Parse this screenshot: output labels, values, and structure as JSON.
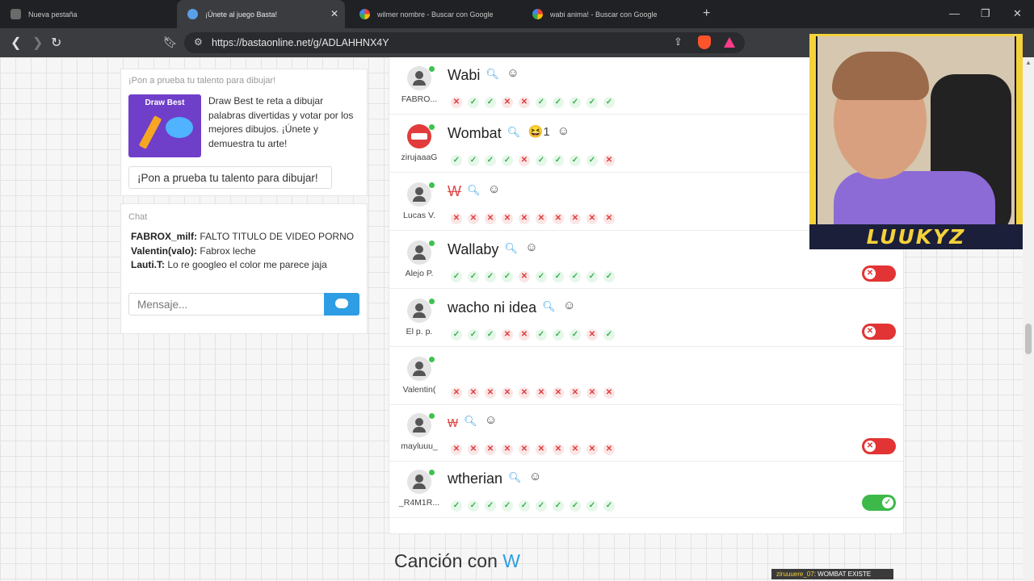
{
  "browser": {
    "tabs": [
      {
        "title": "Nueva pestaña",
        "active": false
      },
      {
        "title": "¡Únete al juego Basta!",
        "active": true
      },
      {
        "title": "wilmer nombre - Buscar con Google",
        "active": false
      },
      {
        "title": "wabi anima! - Buscar con Google",
        "active": false
      }
    ],
    "new_tab": "+",
    "url": "https://bastaonline.net/g/ADLAHHNX4Y",
    "icons": {
      "back": "back-icon",
      "forward": "forward-icon",
      "reload": "reload-icon",
      "bookmark": "bookmark-icon",
      "share": "share-icon",
      "brave": "brave-shield-icon",
      "rewards": "brave-rewards-icon"
    },
    "brave_count": "4"
  },
  "promo": {
    "header": "¡Pon a prueba tu talento para dibujar!",
    "image_title": "Draw Best",
    "text": "Draw Best te reta a dibujar palabras divertidas y votar por los mejores dibujos. ¡Únete y demuestra tu arte!",
    "button": "¡Pon a prueba tu talento para dibujar!"
  },
  "chat": {
    "header": "Chat",
    "messages": [
      {
        "user": "FABROX_milf:",
        "text": "FALTO TITULO DE VIDEO PORNO"
      },
      {
        "user": "Valentin(valo):",
        "text": "Fabrox leche"
      },
      {
        "user": "Lauti.T:",
        "text": "Lo re googleo el color me parece jaja"
      }
    ],
    "placeholder": "Mensaje..."
  },
  "answers": [
    {
      "user": "FABRO...",
      "word": "Wabi",
      "valid": true,
      "reaction": "",
      "marks": [
        "no",
        "ok",
        "ok",
        "no",
        "no",
        "ok",
        "ok",
        "ok",
        "ok",
        "ok"
      ],
      "toggle": ""
    },
    {
      "user": "zirujaaaG",
      "word": "Wombat",
      "valid": true,
      "reaction": "😆1",
      "marks": [
        "ok",
        "ok",
        "ok",
        "ok",
        "no",
        "ok",
        "ok",
        "ok",
        "ok",
        "no"
      ],
      "toggle": "",
      "avatar": "stop"
    },
    {
      "user": "Lucas V.",
      "word": "W",
      "valid": false,
      "reaction": "",
      "marks": [
        "no",
        "no",
        "no",
        "no",
        "no",
        "no",
        "no",
        "no",
        "no",
        "no"
      ],
      "toggle": ""
    },
    {
      "user": "Alejo P.",
      "word": "Wallaby",
      "valid": true,
      "reaction": "",
      "marks": [
        "ok",
        "ok",
        "ok",
        "ok",
        "no",
        "ok",
        "ok",
        "ok",
        "ok",
        "ok"
      ],
      "toggle": "off"
    },
    {
      "user": "El p. p.",
      "word": "wacho ni idea",
      "valid": true,
      "reaction": "",
      "marks": [
        "ok",
        "ok",
        "ok",
        "no",
        "no",
        "ok",
        "ok",
        "ok",
        "no",
        "ok"
      ],
      "toggle": "off"
    },
    {
      "user": "Valentin(",
      "word": "",
      "valid": false,
      "reaction": "",
      "marks": [
        "no",
        "no",
        "no",
        "no",
        "no",
        "no",
        "no",
        "no",
        "no",
        "no"
      ],
      "toggle": ""
    },
    {
      "user": "mayluuu_",
      "word": "w",
      "valid": false,
      "reaction": "",
      "marks": [
        "no",
        "no",
        "no",
        "no",
        "no",
        "no",
        "no",
        "no",
        "no",
        "no"
      ],
      "toggle": "off"
    },
    {
      "user": "_R4M1R...",
      "word": "wtherian",
      "valid": true,
      "reaction": "",
      "marks": [
        "ok",
        "ok",
        "ok",
        "ok",
        "ok",
        "ok",
        "ok",
        "ok",
        "ok",
        "ok"
      ],
      "toggle": "on"
    }
  ],
  "next_section": {
    "label": "Canción con",
    "letter": "W"
  },
  "stream": {
    "streamer": "LUUKYZ",
    "ticker_user": "ziruuuere_07",
    "ticker_text": ": WOMBAT EXISTE"
  },
  "colors": {
    "accent": "#2e9de3",
    "ok": "#37b24d",
    "no": "#e03b3b",
    "streamer": "#f4d23b"
  }
}
